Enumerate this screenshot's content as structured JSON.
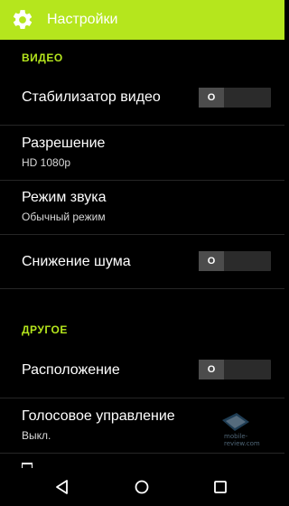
{
  "app_bar": {
    "title": "Настройки",
    "icon": "gear-icon",
    "background": "#b5e61d"
  },
  "sections": {
    "video": {
      "header": "ВИДЕО",
      "stabilizer": {
        "label": "Стабилизатор видео",
        "toggle_state": "O",
        "enabled": false
      },
      "resolution": {
        "label": "Разрешение",
        "value": "HD 1080p"
      },
      "sound_mode": {
        "label": "Режим звука",
        "value": "Обычный режим"
      },
      "noise_reduction": {
        "label": "Снижение шума",
        "toggle_state": "O",
        "enabled": false
      }
    },
    "other": {
      "header": "ДРУГОЕ",
      "location": {
        "label": "Расположение",
        "toggle_state": "O",
        "enabled": false
      },
      "voice_control": {
        "label": "Голосовое управление",
        "value": "Выкл."
      }
    }
  },
  "navigation": {
    "back_icon": "back-triangle-icon",
    "home_icon": "home-circle-icon",
    "recents_icon": "recents-square-icon"
  },
  "watermark": {
    "text": "mobile-review.com"
  },
  "colors": {
    "accent": "#b5e61d",
    "background": "#000000",
    "divider": "#262626",
    "toggle_track": "#2b2b2b",
    "toggle_knob": "#4c4c4c"
  }
}
